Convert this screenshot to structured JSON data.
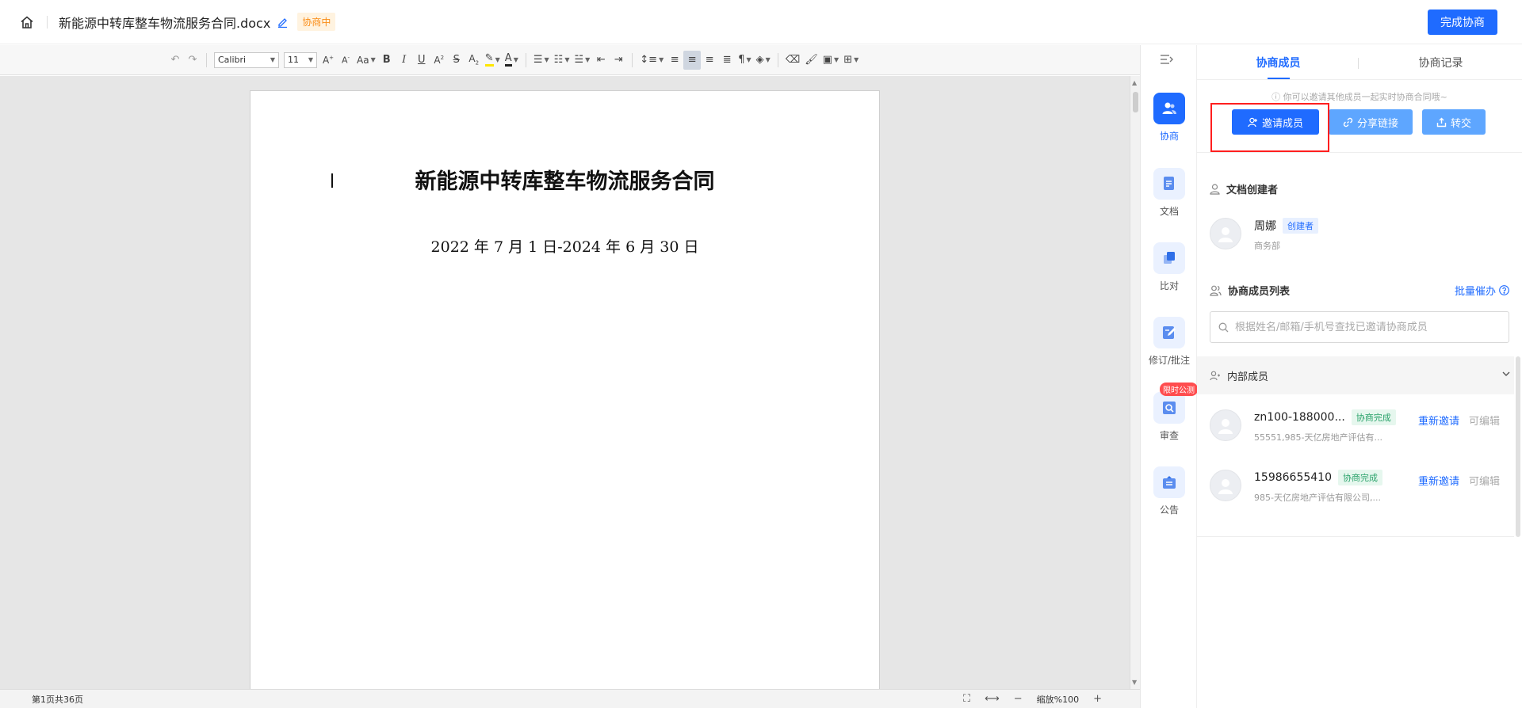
{
  "header": {
    "doc_title": "新能源中转库整车物流服务合同.docx",
    "status": "协商中",
    "finish_button": "完成协商"
  },
  "toolbar": {
    "font_name": "Calibri",
    "font_size": "11"
  },
  "document": {
    "heading": "新能源中转库整车物流服务合同",
    "date_line": "2022 年 7 月 1 日-2024 年 6 月 30 日"
  },
  "statusbar": {
    "page_count": "第1页共36页",
    "zoom": "缩放%100"
  },
  "rail": {
    "items": [
      {
        "label": "协商",
        "icon": "negotiate-icon"
      },
      {
        "label": "文档",
        "icon": "document-icon"
      },
      {
        "label": "比对",
        "icon": "compare-icon"
      },
      {
        "label": "修订/批注",
        "icon": "revision-icon"
      },
      {
        "label": "审查",
        "icon": "review-icon",
        "badge": "限时公测"
      },
      {
        "label": "公告",
        "icon": "notice-icon"
      }
    ]
  },
  "panel": {
    "tabs": [
      "协商成员",
      "协商记录"
    ],
    "invite_hint": "你可以邀请其他成员一起实时协商合同哦~",
    "buttons": {
      "invite": "邀请成员",
      "share": "分享链接",
      "transfer": "转交"
    },
    "creator_section": "文档创建者",
    "creator": {
      "name": "周娜",
      "tag": "创建者",
      "dept": "商务部"
    },
    "members_section": "协商成员列表",
    "batch_remind": "批量催办",
    "search_placeholder": "根据姓名/邮箱/手机号查找已邀请协商成员",
    "group_label": "内部成员",
    "members": [
      {
        "name": "zn100-188000...",
        "status": "协商完成",
        "sub": "55551,985-天亿房地产评估有...",
        "action": "重新邀请",
        "permission": "可编辑"
      },
      {
        "name": "15986655410",
        "status": "协商完成",
        "sub": "985-天亿房地产评估有限公司,...",
        "action": "重新邀请",
        "permission": "可编辑"
      }
    ]
  },
  "colors": {
    "primary": "#1f6bff",
    "light_button": "#5ea6ff",
    "status_orange": "#fa8c16",
    "success_green": "#2ba36b",
    "highlight_red": "#ff1f1f"
  }
}
